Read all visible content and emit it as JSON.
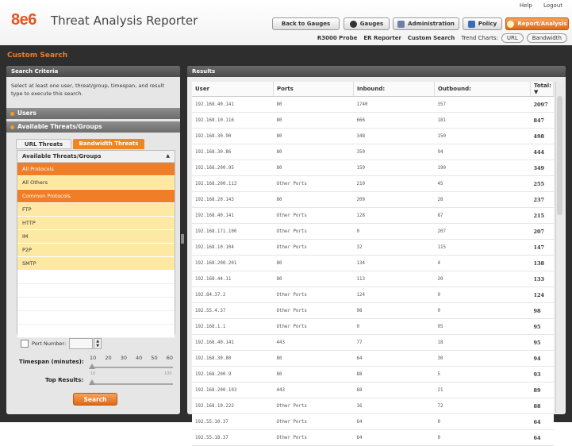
{
  "header": {
    "logo": "8e6",
    "title": "Threat Analysis Reporter",
    "links": [
      "Help",
      "Logout"
    ],
    "nav": [
      {
        "label": "Back to Gauges"
      },
      {
        "label": "Gauges"
      },
      {
        "label": "Administration"
      },
      {
        "label": "Policy"
      },
      {
        "label": "Report/Analysis"
      }
    ],
    "subnav": {
      "r3000": "R3000 Probe",
      "er": "ER Reporter",
      "custom": "Custom Search",
      "trend": "Trend Charts:",
      "url": "URL",
      "bandwidth": "Bandwidth"
    },
    "colors": {
      "accent": "#f07e26",
      "bar": "#2e2e2e"
    }
  },
  "page_title": "Custom Search",
  "search": {
    "title": "Search Criteria",
    "instructions": "Select at least one user, threat/group, timespan, and result type to execute this search.",
    "users_label": "Users",
    "threats_label": "Available Threats/Groups",
    "tabs": [
      "URL Threats",
      "Bandwidth Threats"
    ],
    "list_header": "Available Threats/Groups",
    "list_items": [
      {
        "label": "All Protocols",
        "state": "selected"
      },
      {
        "label": "All Others",
        "state": "yellow"
      },
      {
        "label": "Common Protocols",
        "state": "selected"
      },
      {
        "label": "FTP",
        "state": "yellow"
      },
      {
        "label": "HTTP",
        "state": "yellow"
      },
      {
        "label": "IM",
        "state": "yellow"
      },
      {
        "label": "P2P",
        "state": "yellow"
      },
      {
        "label": "SMTP",
        "state": "yellow"
      }
    ],
    "port_label": "Port Number:",
    "timespan_label": "Timespan (minutes):",
    "timespan_ticks": [
      "10",
      "20",
      "30",
      "40",
      "50",
      "60"
    ],
    "top_results_label": "Top Results:",
    "top_min": "10",
    "top_max": "100",
    "search_button": "Search"
  },
  "results": {
    "title": "Results",
    "columns": [
      "User",
      "Ports",
      "Inbound:",
      "Outbound:",
      "Total: ▼"
    ],
    "rows": [
      [
        "192.168.40.141",
        "80",
        "1740",
        "357",
        "2097"
      ],
      [
        "192.168.10.116",
        "80",
        "666",
        "181",
        "847"
      ],
      [
        "192.168.30.90",
        "80",
        "348",
        "150",
        "498"
      ],
      [
        "192.168.30.86",
        "80",
        "350",
        "94",
        "444"
      ],
      [
        "192.168.200.95",
        "80",
        "159",
        "190",
        "349"
      ],
      [
        "192.168.200.113",
        "Other Ports",
        "210",
        "45",
        "255"
      ],
      [
        "192.168.20.143",
        "80",
        "209",
        "28",
        "237"
      ],
      [
        "192.168.40.141",
        "Other Ports",
        "128",
        "87",
        "215"
      ],
      [
        "192.168.171.100",
        "Other Ports",
        "0",
        "207",
        "207"
      ],
      [
        "192.168.10.104",
        "Other Ports",
        "32",
        "115",
        "147"
      ],
      [
        "192.168.200.201",
        "80",
        "134",
        "4",
        "138"
      ],
      [
        "192.168.44.11",
        "80",
        "113",
        "20",
        "133"
      ],
      [
        "192.84.37.2",
        "Other Ports",
        "124",
        "0",
        "124"
      ],
      [
        "192.55.4.37",
        "Other Ports",
        "98",
        "0",
        "98"
      ],
      [
        "192.168.1.1",
        "Other Ports",
        "0",
        "95",
        "95"
      ],
      [
        "192.168.40.141",
        "443",
        "77",
        "18",
        "95"
      ],
      [
        "192.168.30.80",
        "80",
        "64",
        "30",
        "94"
      ],
      [
        "192.168.200.9",
        "80",
        "88",
        "5",
        "93"
      ],
      [
        "192.168.200.103",
        "443",
        "68",
        "21",
        "89"
      ],
      [
        "192.168.10.222",
        "Other Ports",
        "16",
        "72",
        "88"
      ],
      [
        "192.55.10.37",
        "Other Ports",
        "64",
        "0",
        "64"
      ],
      [
        "192.55.18.37",
        "Other Ports",
        "64",
        "0",
        "64"
      ]
    ]
  }
}
